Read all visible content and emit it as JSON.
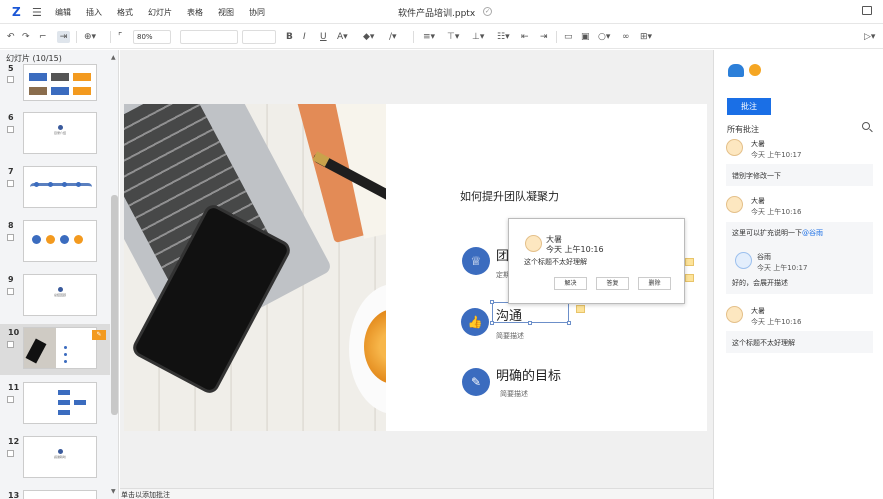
{
  "app": {
    "logo": "Z",
    "menu": [
      "编辑",
      "插入",
      "格式",
      "幻灯片",
      "表格",
      "视图",
      "协同"
    ],
    "doc_title": "软件产品培训.pptx"
  },
  "toolbar": {
    "zoom": "80%",
    "font_size": "",
    "font_name": ""
  },
  "left_panel": {
    "header": "幻灯片 (10/15)",
    "slides": [
      {
        "num": "5",
        "thumb": ""
      },
      {
        "num": "6",
        "thumb": "目录介绍"
      },
      {
        "num": "7",
        "thumb": ""
      },
      {
        "num": "8",
        "thumb": ""
      },
      {
        "num": "9",
        "thumb": "总结回顾"
      },
      {
        "num": "10",
        "thumb": "",
        "selected": true,
        "has_comment": true
      },
      {
        "num": "11",
        "thumb": ""
      },
      {
        "num": "12",
        "thumb": "感谢聆听"
      },
      {
        "num": "13",
        "thumb": ""
      }
    ]
  },
  "slide": {
    "heading": "如何提升团队凝聚力",
    "points": [
      {
        "title": "团",
        "desc": "定期",
        "icon": "medal-icon"
      },
      {
        "title": "沟通",
        "desc": "简要描述",
        "icon": "thumbs-up-icon"
      },
      {
        "title": "明确的目标",
        "desc": "简要描述",
        "icon": "pencil-icon"
      }
    ]
  },
  "popup": {
    "name": "大暑",
    "time": "今天 上午10:16",
    "text": "这个标题不太好理解",
    "buttons": [
      "解决",
      "答复",
      "删除"
    ]
  },
  "status": {
    "text": "单击以添加批注"
  },
  "right_panel": {
    "add_button": "批注",
    "all_label": "所有批注",
    "comments": [
      {
        "name": "大暑",
        "time": "今天 上午10:17",
        "text": "错别字修改一下"
      },
      {
        "name": "大暑",
        "time": "今天 上午10:16",
        "text_before": "这里可以扩充说明一下",
        "mention": "@谷雨",
        "reply": {
          "name": "谷雨",
          "time": "今天 上午10:17",
          "text": "好的，会展开描述"
        }
      },
      {
        "name": "大暑",
        "time": "今天 上午10:16",
        "text": "这个标题不太好理解"
      }
    ]
  }
}
